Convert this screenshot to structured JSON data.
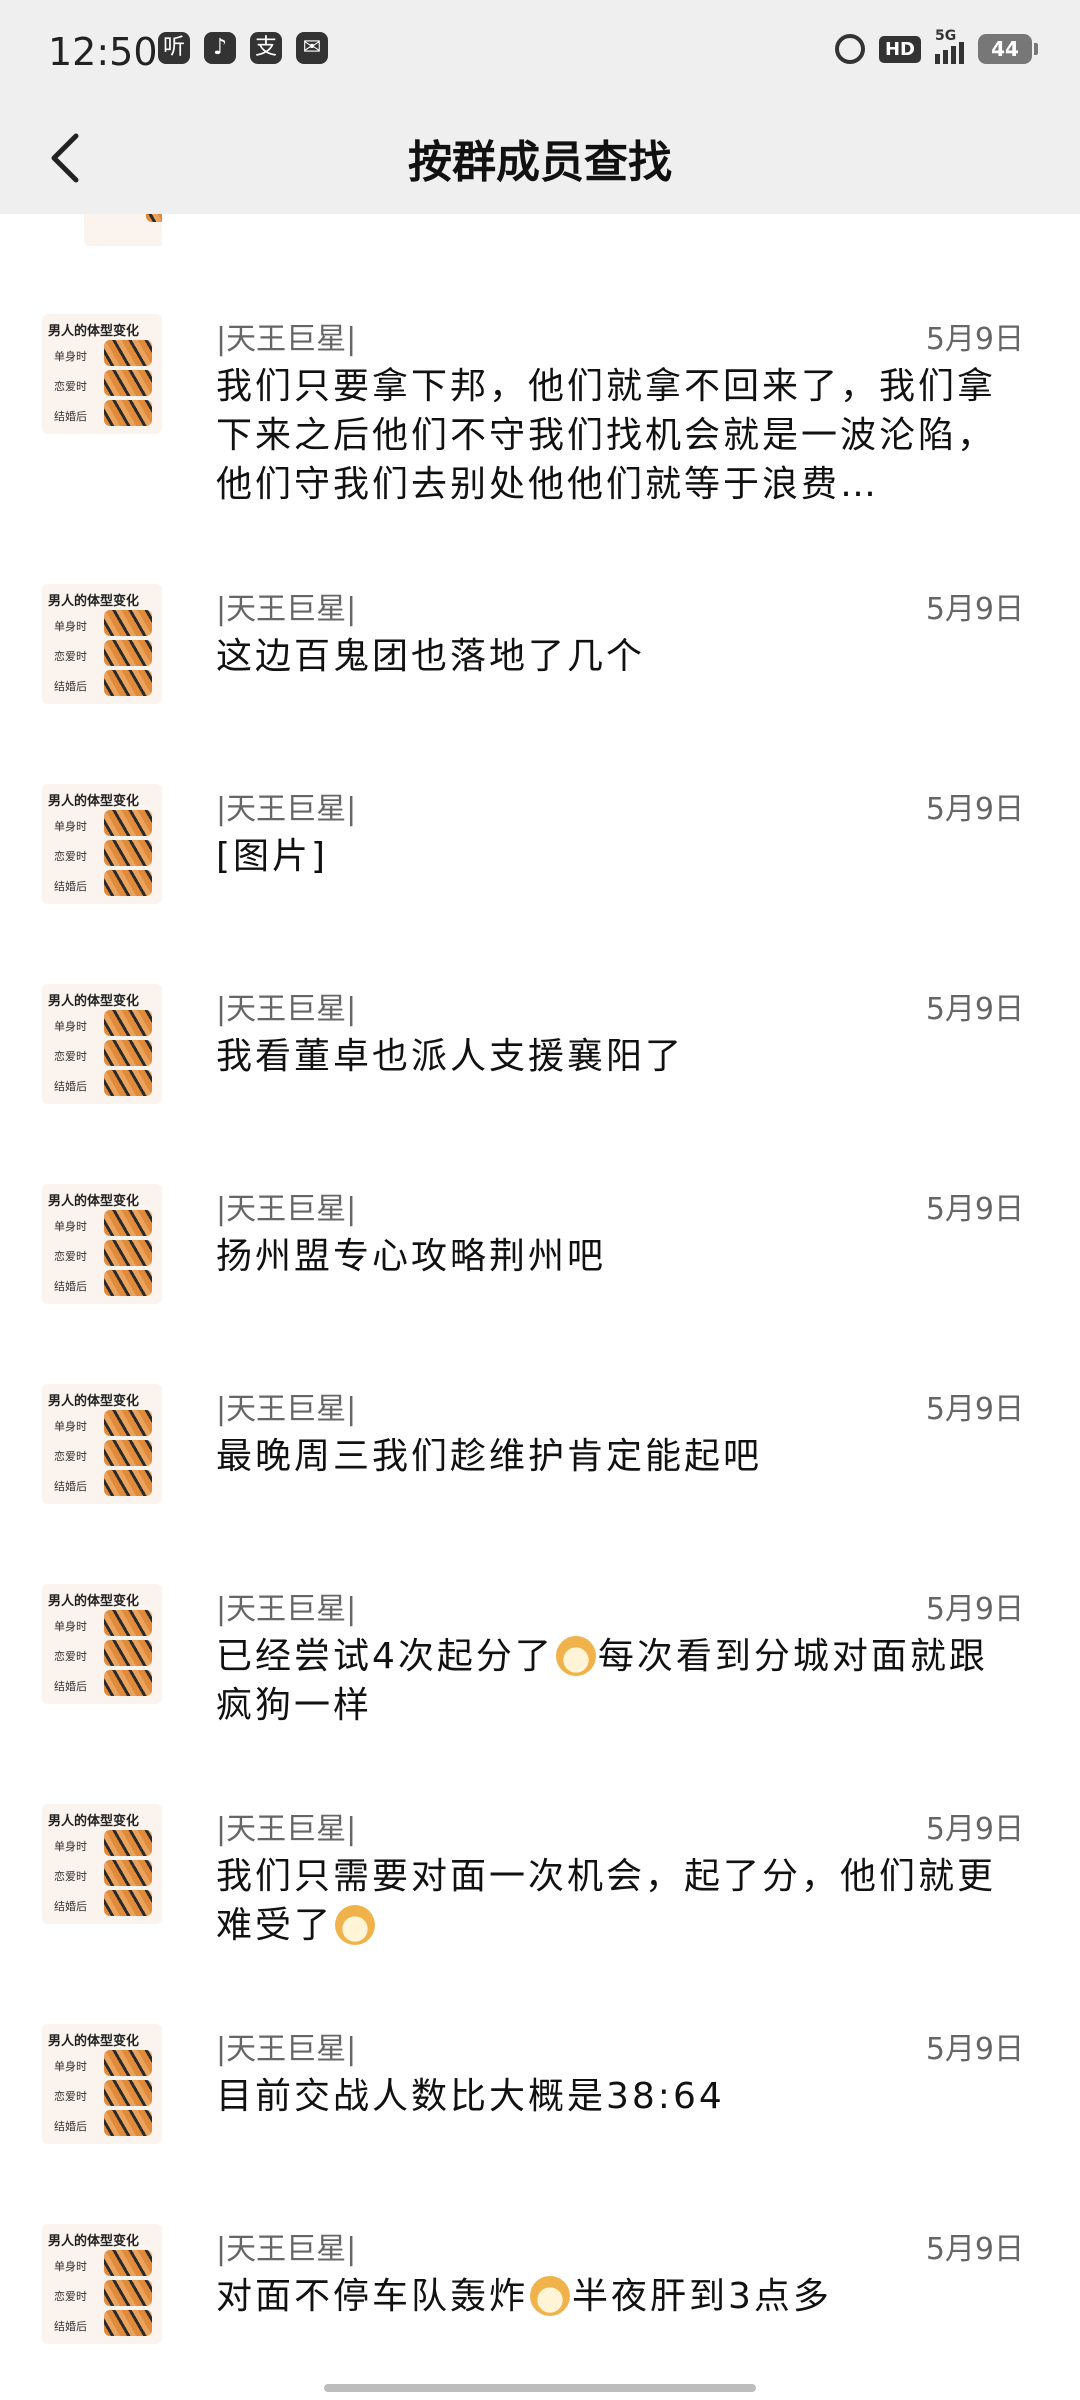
{
  "status_bar": {
    "time": "12:50",
    "app_icons": [
      {
        "icon": "ting-app-icon",
        "glyph": "听"
      },
      {
        "icon": "tiktok-icon",
        "glyph": "♪"
      },
      {
        "icon": "alipay-icon",
        "glyph": "支"
      },
      {
        "icon": "wechat-icon",
        "glyph": "✉"
      }
    ],
    "hd": "HD",
    "network": "5G",
    "battery": "44"
  },
  "nav": {
    "title": "按群成员查找"
  },
  "avatar": {
    "caption": "男人的体型变化",
    "rows": [
      "单身时",
      "恋爱时",
      "结婚后"
    ]
  },
  "messages": [
    {
      "sender": "|天王巨星|",
      "date": "5月9日",
      "text": "我们只要拿下邦，他们就拿不回来了，我们拿下来之后他们不守我们找机会就是一波沦陷，他们守我们去别处他他们就等于浪费…"
    },
    {
      "sender": "|天王巨星|",
      "date": "5月9日",
      "text": "这边百鬼团也落地了几个"
    },
    {
      "sender": "|天王巨星|",
      "date": "5月9日",
      "text": "[图片]"
    },
    {
      "sender": "|天王巨星|",
      "date": "5月9日",
      "text": "我看董卓也派人支援襄阳了"
    },
    {
      "sender": "|天王巨星|",
      "date": "5月9日",
      "text": "扬州盟专心攻略荆州吧"
    },
    {
      "sender": "|天王巨星|",
      "date": "5月9日",
      "text": "最晚周三我们趁维护肯定能起吧"
    },
    {
      "sender": "|天王巨星|",
      "date": "5月9日",
      "text_before": "已经尝试4次起分了",
      "emoji": "doge-emoji",
      "text_after": "每次看到分城对面就跟疯狗一样"
    },
    {
      "sender": "|天王巨星|",
      "date": "5月9日",
      "text_before": "我们只需要对面一次机会，起了分，他们就更难受了",
      "emoji": "doge-emoji",
      "text_after": ""
    },
    {
      "sender": "|天王巨星|",
      "date": "5月9日",
      "text": "目前交战人数比大概是38:64"
    },
    {
      "sender": "|天王巨星|",
      "date": "5月9日",
      "text_before": "对面不停车队轰炸",
      "emoji": "doge-emoji",
      "text_after": "半夜肝到3点多"
    }
  ]
}
